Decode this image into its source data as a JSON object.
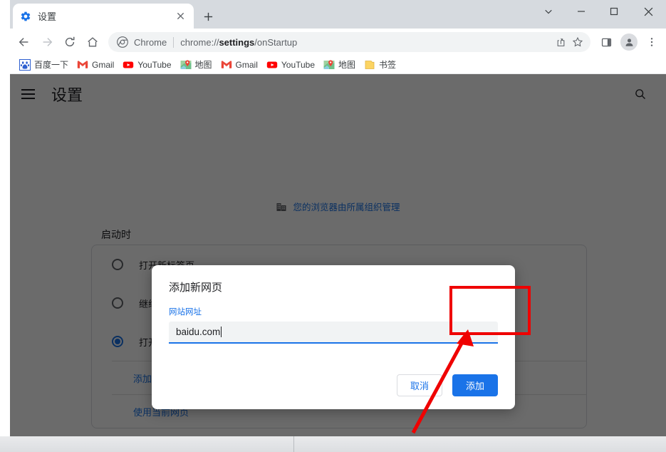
{
  "window": {
    "controls": {
      "minimize": "–",
      "maximize": "□",
      "close": "✕",
      "tabsearch": "⌄"
    }
  },
  "tabs": [
    {
      "title": "设置",
      "favicon": "settings-gear-icon",
      "close_label": "✕"
    }
  ],
  "newtab_label": "+",
  "toolbar": {
    "back": "←",
    "forward": "→",
    "reload": "⟳",
    "home": "⌂",
    "share": "share-icon",
    "bookmark_star": "star-icon",
    "side_panel": "side-panel-icon",
    "profile": "profile-avatar-icon",
    "menu": "three-dot-menu-icon"
  },
  "omnibox": {
    "chip": "Chrome",
    "url_prefix": "chrome://",
    "url_bold": "settings",
    "url_suffix": "/onStartup"
  },
  "bookmarks": [
    {
      "label": "百度一下",
      "icon": "baidu-icon"
    },
    {
      "label": "Gmail",
      "icon": "gmail-icon"
    },
    {
      "label": "YouTube",
      "icon": "youtube-icon"
    },
    {
      "label": "地图",
      "icon": "maps-icon"
    },
    {
      "label": "Gmail",
      "icon": "gmail-icon"
    },
    {
      "label": "YouTube",
      "icon": "youtube-icon"
    },
    {
      "label": "地图",
      "icon": "maps-icon"
    },
    {
      "label": "书签",
      "icon": "folder-icon"
    }
  ],
  "settings": {
    "menu_icon": "hamburger-menu-icon",
    "title": "设置",
    "search_icon": "search-icon",
    "managed_notice": "您的浏览器由所属组织管理",
    "managed_icon": "building-icon",
    "section_label": "启动时",
    "options": [
      {
        "label": "打开新标签页",
        "checked": false
      },
      {
        "label": "继续浏览上次打开的网页",
        "checked": false
      },
      {
        "label": "打开特定网页或一组网页",
        "checked": true
      }
    ],
    "links": [
      "添加新网页",
      "使用当前网页"
    ]
  },
  "dialog": {
    "title": "添加新网页",
    "field_label": "网站网址",
    "field_value": "baidu.com",
    "cancel_label": "取消",
    "add_label": "添加"
  },
  "annotation": {
    "color": "#ef0000",
    "shape": "rectangle-and-arrow",
    "target": "添加"
  },
  "colors": {
    "accent": "#1a73e8",
    "annotation": "#ef0000",
    "tabstrip": "#d6dadf",
    "scrim": "rgba(0,0,0,0.58)"
  }
}
